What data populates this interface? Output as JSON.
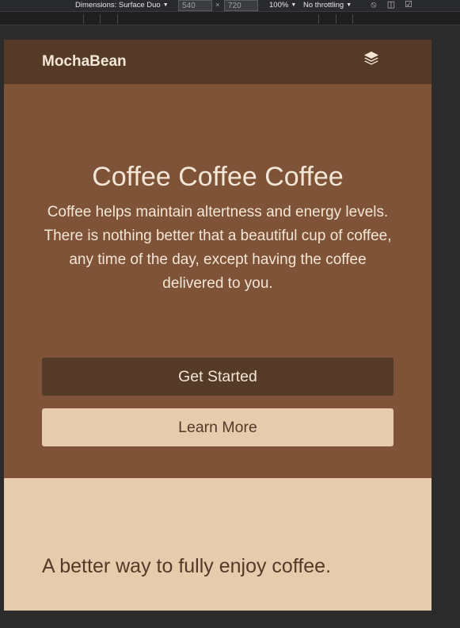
{
  "devtools": {
    "dimensions_label": "Dimensions: Surface Duo",
    "width_value": "540",
    "times": "×",
    "height_value": "720",
    "zoom": "100%",
    "throttling": "No throttling"
  },
  "navbar": {
    "brand": "MochaBean",
    "menu_icon": "layers-icon"
  },
  "hero": {
    "title": "Coffee Coffee Coffee",
    "description": "Coffee helps maintain altertness and energy levels. There is nothing better that a beautiful cup of coffee, any time of the day, except having the coffee delivered to you.",
    "primary_button": "Get Started",
    "secondary_button": "Learn More"
  },
  "feature": {
    "heading": "A better way to fully enjoy coffee."
  },
  "colors": {
    "dark_brown": "#553a28",
    "medium_brown": "#7e5337",
    "cream": "#e6cbad",
    "light_text": "#f4e6d6"
  }
}
